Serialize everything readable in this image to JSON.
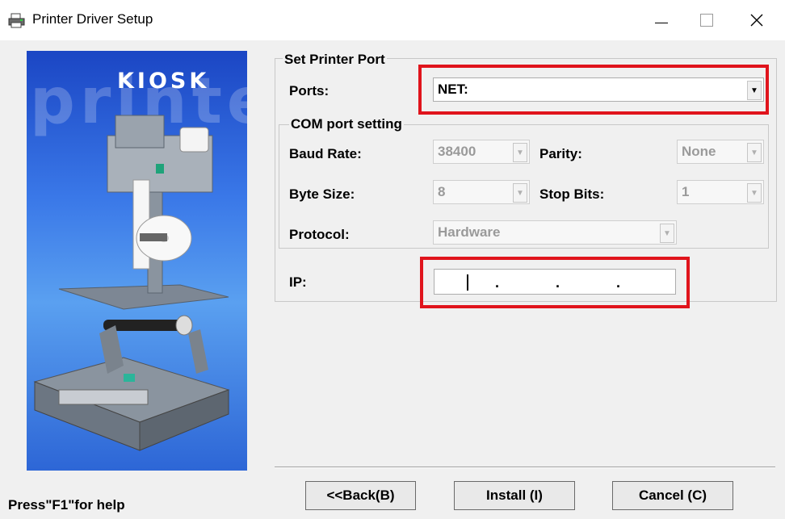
{
  "window": {
    "title": "Printer Driver Setup",
    "controls": {
      "minimize": "—",
      "maximize": "☐",
      "close": "✕"
    }
  },
  "banner": {
    "background_word": "printer",
    "brand": "KIOSK"
  },
  "set_port_group": {
    "legend": "Set Printer Port",
    "ports_label": "Ports:",
    "ports_value": "NET:"
  },
  "com_group": {
    "legend": "COM port setting",
    "baud_rate_label": "Baud Rate:",
    "baud_rate_value": "38400",
    "parity_label": "Parity:",
    "parity_value": "None",
    "byte_size_label": "Byte Size:",
    "byte_size_value": "8",
    "stop_bits_label": "Stop Bits:",
    "stop_bits_value": "1",
    "protocol_label": "Protocol:",
    "protocol_value": "Hardware"
  },
  "ip": {
    "label": "IP:",
    "separator": "."
  },
  "buttons": {
    "back": "<<Back(B)",
    "install": "Install (I)",
    "cancel": "Cancel (C)"
  },
  "status": {
    "help_text": "Press\"F1\"for help"
  },
  "colors": {
    "highlight": "#e0141c",
    "banner": "#2d66d6"
  }
}
